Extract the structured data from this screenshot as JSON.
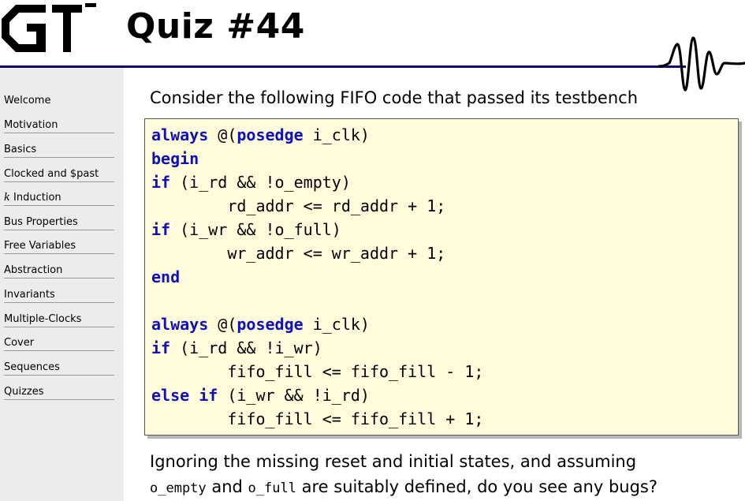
{
  "header": {
    "logo_text": "GT",
    "title": "Quiz #44"
  },
  "sidebar": {
    "items": [
      {
        "label": "Welcome"
      },
      {
        "label": "Motivation"
      },
      {
        "label": "Basics"
      },
      {
        "label": "Clocked and $past"
      },
      {
        "label": "k Induction",
        "italic_prefix": "k",
        "rest": " Induction"
      },
      {
        "label": "Bus Properties"
      },
      {
        "label": "Free Variables"
      },
      {
        "label": "Abstraction"
      },
      {
        "label": "Invariants"
      },
      {
        "label": "Multiple-Clocks"
      },
      {
        "label": "Cover"
      },
      {
        "label": "Sequences"
      },
      {
        "label": "Quizzes"
      }
    ]
  },
  "content": {
    "intro": "Consider the following FIFO code that passed its testbench",
    "code": {
      "l1_kw1": "always",
      "l1_mid": " @(",
      "l1_kw2": "posedge",
      "l1_rest": " i_clk)",
      "l2_kw": "begin",
      "l3_kw": "if",
      "l3_rest": " (i_rd && !o_empty)",
      "l4": "        rd_addr <= rd_addr + 1;",
      "l5_kw": "if",
      "l5_rest": " (i_wr && !o_full)",
      "l6": "        wr_addr <= wr_addr + 1;",
      "l7_kw": "end",
      "l9_kw1": "always",
      "l9_mid": " @(",
      "l9_kw2": "posedge",
      "l9_rest": " i_clk)",
      "l10_kw": "if",
      "l10_rest": " (i_rd && !i_wr)",
      "l11": "        fifo_fill <= fifo_fill - 1;",
      "l12_kw": "else if",
      "l12_rest": " (i_wr && !i_rd)",
      "l13": "        fifo_fill <= fifo_fill + 1;"
    },
    "outro": {
      "line1": "Ignoring the missing reset and initial states, and assuming",
      "sig1": "o_empty",
      "and": " and ",
      "sig2": "o_full",
      "line2_rest": " are suitably defined, do you see any bugs?"
    }
  },
  "colors": {
    "keyword": "#1010b8",
    "code_background": "#fffbdb",
    "sidebar_background": "#ececec",
    "rule": "#0b0b6e"
  }
}
